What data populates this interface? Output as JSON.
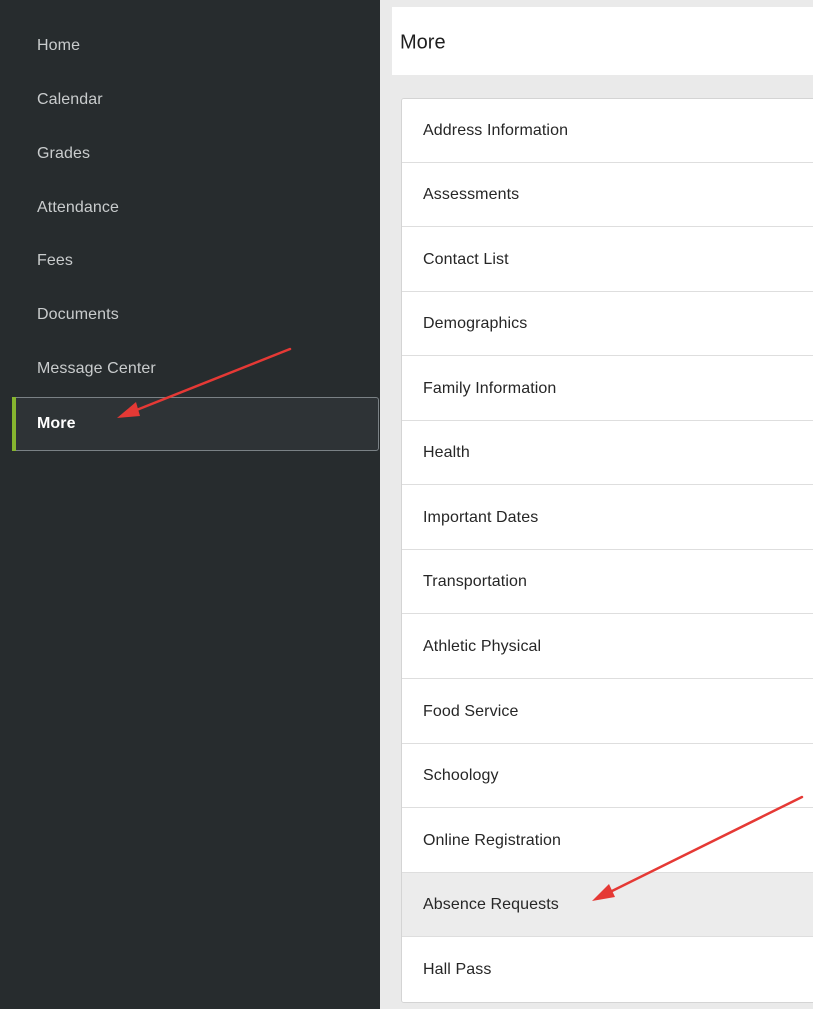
{
  "sidebar": {
    "items": [
      {
        "label": "Home"
      },
      {
        "label": "Calendar"
      },
      {
        "label": "Grades"
      },
      {
        "label": "Attendance"
      },
      {
        "label": "Fees"
      },
      {
        "label": "Documents"
      },
      {
        "label": "Message Center"
      },
      {
        "label": "More"
      }
    ],
    "active_item": "More"
  },
  "header": {
    "title": "More"
  },
  "more_list": {
    "items": [
      {
        "label": "Address Information"
      },
      {
        "label": "Assessments"
      },
      {
        "label": "Contact List"
      },
      {
        "label": "Demographics"
      },
      {
        "label": "Family Information"
      },
      {
        "label": "Health"
      },
      {
        "label": "Important Dates"
      },
      {
        "label": "Transportation"
      },
      {
        "label": "Athletic Physical"
      },
      {
        "label": "Food Service"
      },
      {
        "label": "Schoology"
      },
      {
        "label": "Online Registration"
      },
      {
        "label": "Absence Requests"
      },
      {
        "label": "Hall Pass"
      }
    ],
    "highlighted_item": "Absence Requests"
  },
  "colors": {
    "sidebar_bg": "#272c2e",
    "active_accent": "#86b52f",
    "annotation_arrow": "#e53935",
    "content_bg": "#eaeaea"
  }
}
